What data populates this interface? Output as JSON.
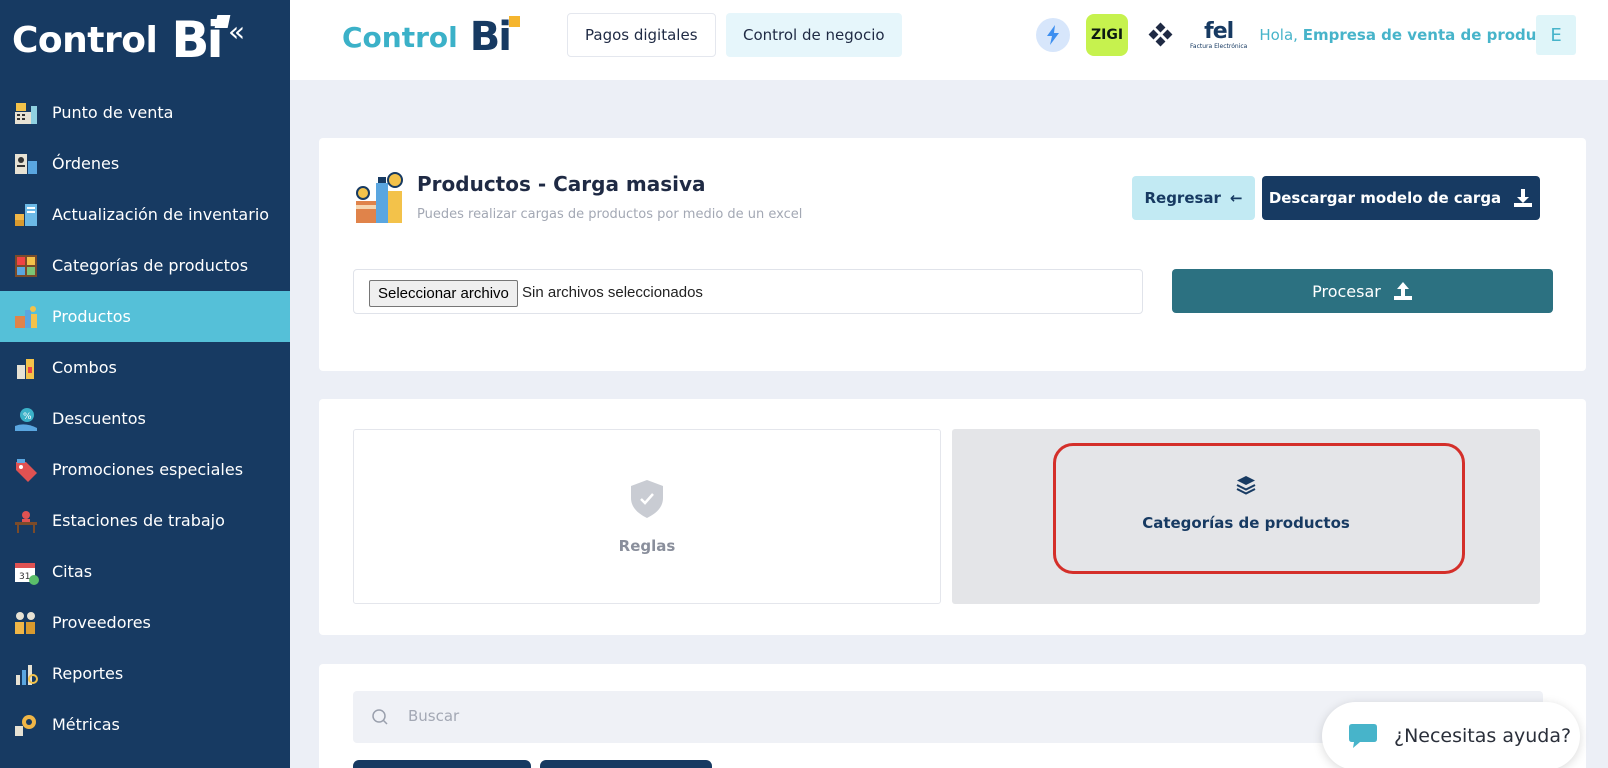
{
  "brand": {
    "name": "Control",
    "bi": "Bi"
  },
  "sidebar": {
    "collapse": "«",
    "items": [
      {
        "label": "Punto de venta",
        "icon": "cash-register-icon"
      },
      {
        "label": "Órdenes",
        "icon": "orders-icon"
      },
      {
        "label": "Actualización de inventario",
        "icon": "inventory-icon"
      },
      {
        "label": "Categorías de productos",
        "icon": "categories-icon"
      },
      {
        "label": "Productos",
        "icon": "products-icon",
        "active": true
      },
      {
        "label": "Combos",
        "icon": "combos-icon"
      },
      {
        "label": "Descuentos",
        "icon": "discount-icon"
      },
      {
        "label": "Promociones especiales",
        "icon": "promo-tag-icon"
      },
      {
        "label": "Estaciones de trabajo",
        "icon": "workstation-icon"
      },
      {
        "label": "Citas",
        "icon": "calendar-icon"
      },
      {
        "label": "Proveedores",
        "icon": "suppliers-icon"
      },
      {
        "label": "Reportes",
        "icon": "reports-icon"
      },
      {
        "label": "Métricas",
        "icon": "metrics-icon"
      }
    ]
  },
  "header": {
    "tabs": [
      "Pagos digitales",
      "Control de negocio"
    ],
    "zigi": "ZIGI",
    "fel": "fel",
    "fel_sub": "Factura Electrónica",
    "greeting": "Hola,",
    "company": "Empresa de venta de productos",
    "avatar": "E"
  },
  "upload": {
    "title": "Productos - Carga masiva",
    "subtitle": "Puedes realizar cargas de productos por medio de un excel",
    "back_label": "Regresar",
    "back_arrow": "←",
    "download_label": "Descargar modelo de carga",
    "file_button": "Seleccionar archivo",
    "file_status": "Sin archivos seleccionados",
    "process_label": "Procesar"
  },
  "options": {
    "rules_label": "Reglas",
    "categories_label": "Categorías de productos"
  },
  "search": {
    "placeholder": "Buscar"
  },
  "help": {
    "label": "¿Necesitas ayuda?"
  },
  "colors": {
    "sidebar": "#173a62",
    "active": "#55c0d8",
    "accent": "#3bb1c8",
    "process": "#2c7181",
    "highlight": "#d42f2a"
  }
}
